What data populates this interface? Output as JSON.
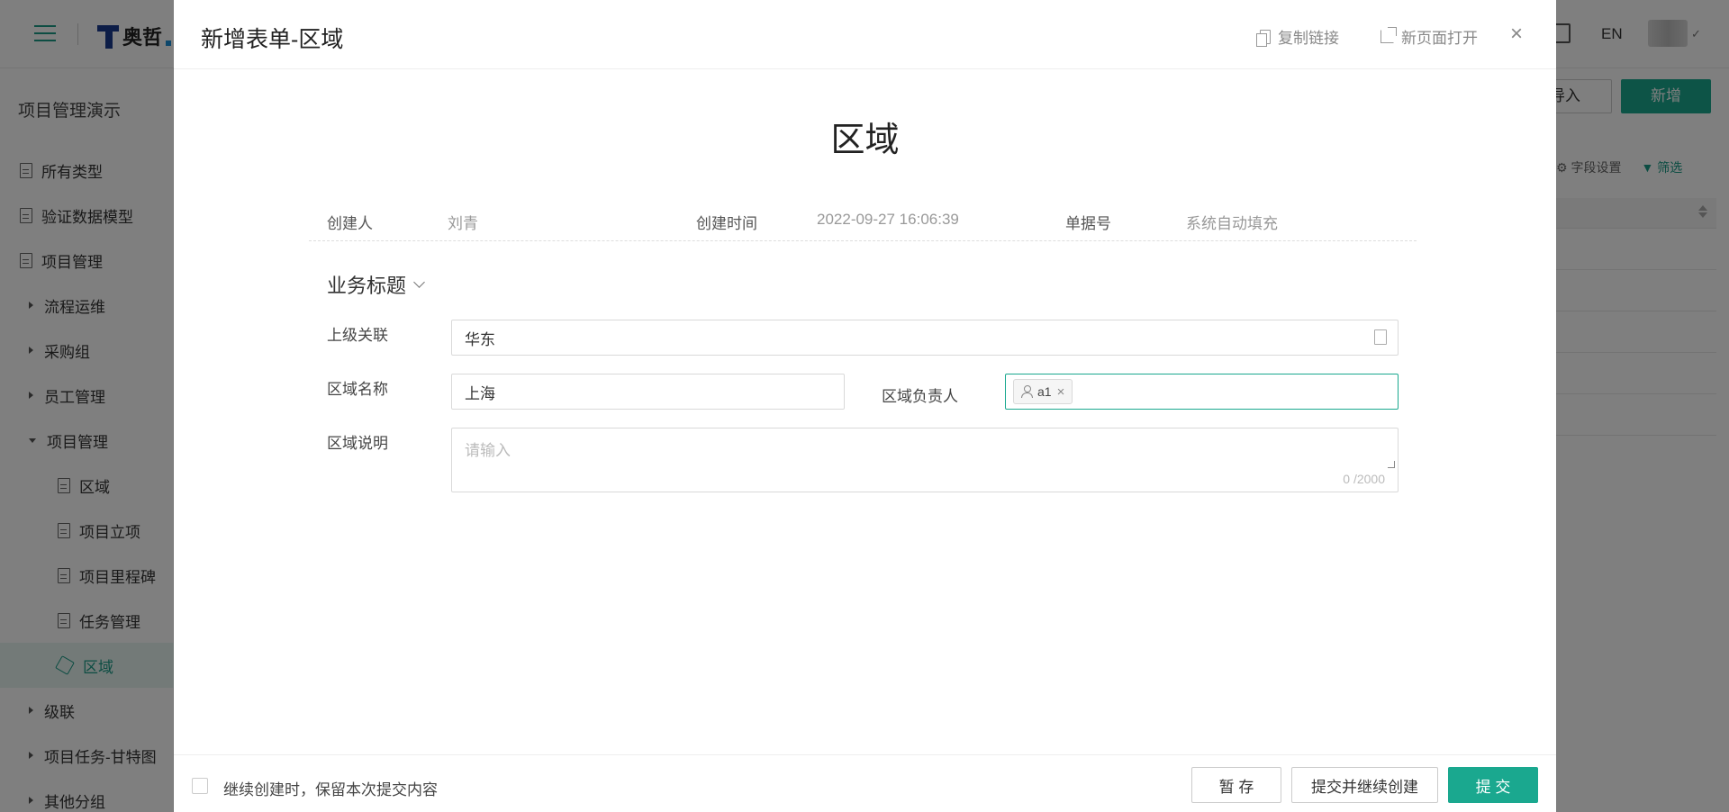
{
  "app": {
    "lang": "EN",
    "logo_text": "奥哲",
    "sidebar_title": "项目管理演示",
    "sidebar": [
      {
        "label": "所有类型",
        "kind": "doc",
        "indent": 0
      },
      {
        "label": "验证数据模型",
        "kind": "doc",
        "indent": 0
      },
      {
        "label": "项目管理",
        "kind": "doc",
        "indent": 0
      },
      {
        "label": "流程运维",
        "kind": "caret",
        "indent": 0
      },
      {
        "label": "采购组",
        "kind": "caret",
        "indent": 0
      },
      {
        "label": "员工管理",
        "kind": "caret",
        "indent": 0
      },
      {
        "label": "项目管理",
        "kind": "caret-open",
        "indent": 0
      },
      {
        "label": "区域",
        "kind": "doc",
        "indent": 1
      },
      {
        "label": "项目立项",
        "kind": "doc",
        "indent": 1
      },
      {
        "label": "项目里程碑",
        "kind": "doc",
        "indent": 1
      },
      {
        "label": "任务管理",
        "kind": "doc",
        "indent": 1
      },
      {
        "label": "区域",
        "kind": "cube",
        "indent": 1,
        "active": true
      },
      {
        "label": "级联",
        "kind": "caret",
        "indent": 0
      },
      {
        "label": "项目任务-甘特图",
        "kind": "caret",
        "indent": 0
      },
      {
        "label": "其他分组",
        "kind": "caret",
        "indent": 0
      }
    ],
    "import_label": "导入",
    "new_label": "新增",
    "field_settings_label": "字段设置",
    "filter_label": "筛选"
  },
  "modal": {
    "title": "新增表单-区域",
    "copy_link": "复制链接",
    "open_new_page": "新页面打开",
    "close_glyph": "×",
    "form_title": "区域",
    "meta": {
      "creator_label": "创建人",
      "creator_value": "刘青",
      "created_time_label": "创建时间",
      "created_time_value": "2022-09-27 16:06:39",
      "doc_no_label": "单据号",
      "doc_no_value": "系统自动填充"
    },
    "section_title": "业务标题",
    "fields": {
      "parent_label": "上级关联",
      "parent_value": "华东",
      "region_name_label": "区域名称",
      "region_name_value": "上海",
      "owner_label": "区域负责人",
      "owner_tag": "a1",
      "description_label": "区域说明",
      "description_placeholder": "请输入",
      "description_count": "0 /2000"
    },
    "footer": {
      "keep_content_label": "继续创建时，保留本次提交内容",
      "save_draft": "暂 存",
      "submit_continue": "提交并继续创建",
      "submit": "提 交"
    }
  },
  "colors": {
    "primary": "#1aa88f",
    "overlay": "rgba(0,0,0,0.5)"
  }
}
